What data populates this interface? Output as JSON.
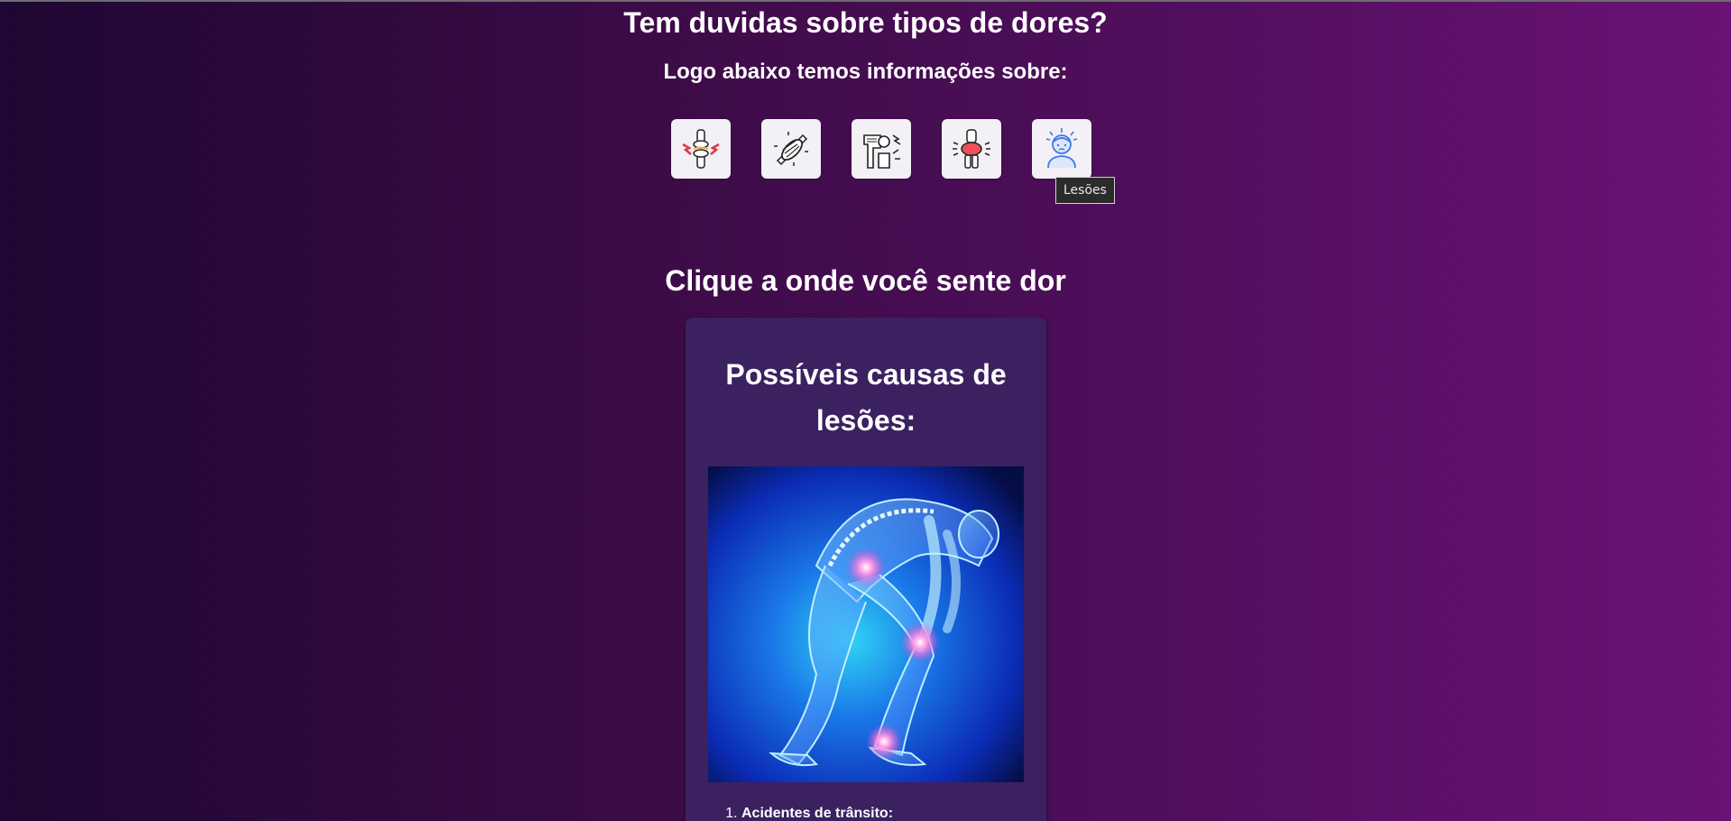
{
  "header": {
    "title": "Tem duvidas sobre tipos de dores?",
    "subtitle": "Logo abaixo temos informações sobre:"
  },
  "categories": [
    {
      "icon": "joint-pain-icon"
    },
    {
      "icon": "muscle-icon"
    },
    {
      "icon": "bone-fracture-icon"
    },
    {
      "icon": "knee-inflammation-icon"
    },
    {
      "icon": "head-injury-icon",
      "tooltip": "Lesões"
    }
  ],
  "section": {
    "title": "Clique a onde você sente dor"
  },
  "card": {
    "title": "Possíveis causas de lesões:",
    "causes": [
      "Acidentes de trânsito:"
    ]
  },
  "colors": {
    "background_left": "#1e0733",
    "background_right": "#6a1275",
    "card": "#3b2160",
    "icon_tile": "#f3f0f6"
  }
}
